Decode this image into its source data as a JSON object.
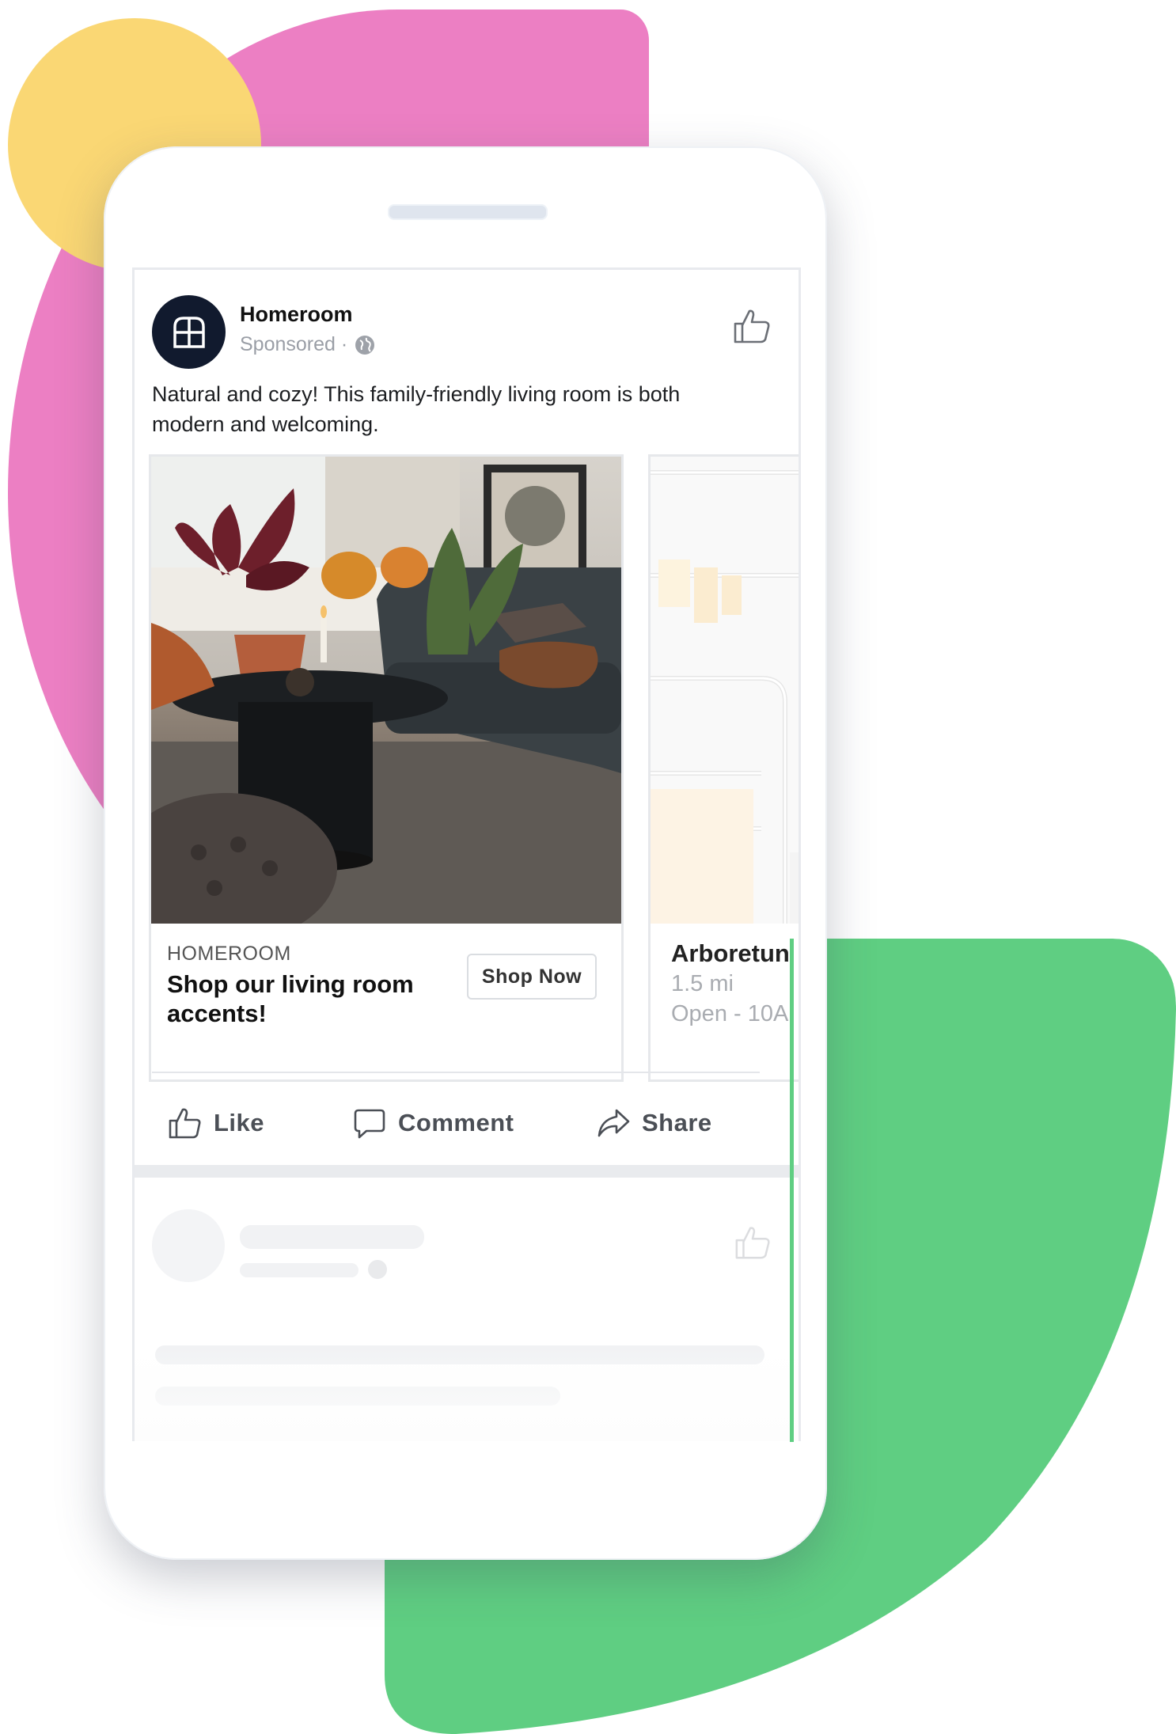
{
  "colors": {
    "accent_yellow": "#fad774",
    "accent_pink": "#ec7fc3",
    "accent_green": "#5fce82",
    "avatar_bg": "#111a2e"
  },
  "post": {
    "page_name": "Homeroom",
    "meta_label": "Sponsored ·",
    "audience_icon": "globe-icon",
    "caption": "Natural and cozy! This family-friendly living room is both modern and welcoming.",
    "carousel": [
      {
        "source": "HOMEROOM",
        "headline": "Shop our living room accents!",
        "cta": "Shop Now"
      },
      {
        "title": "Arboretun",
        "distance": "1.5 mi",
        "hours": "Open - 10A"
      }
    ],
    "actions": {
      "like": "Like",
      "comment": "Comment",
      "share": "Share"
    }
  }
}
